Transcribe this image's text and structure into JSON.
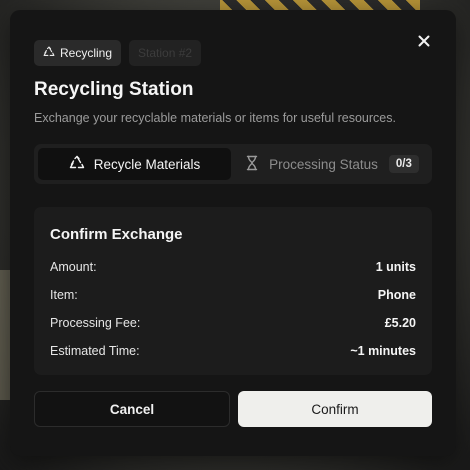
{
  "badges": {
    "primary": {
      "icon": "recycle-icon",
      "label": "Recycling"
    },
    "secondary": {
      "label": "Station #2"
    }
  },
  "close": {
    "icon": "close-icon"
  },
  "header": {
    "title": "Recycling Station",
    "subtitle": "Exchange your recyclable materials or items for useful resources."
  },
  "tabs": [
    {
      "icon": "recycle-icon",
      "label": "Recycle Materials",
      "active": true
    },
    {
      "icon": "hourglass-icon",
      "label": "Processing Status",
      "count": "0/3",
      "active": false
    }
  ],
  "confirm_card": {
    "title": "Confirm Exchange",
    "rows": [
      {
        "label": "Amount:",
        "value": "1 units"
      },
      {
        "label": "Item:",
        "value": "Phone"
      },
      {
        "label": "Processing Fee:",
        "value": "£5.20"
      },
      {
        "label": "Estimated Time:",
        "value": "~1 minutes"
      }
    ]
  },
  "actions": {
    "cancel_label": "Cancel",
    "confirm_label": "Confirm"
  },
  "colors": {
    "modal_bg": "#151515",
    "card_bg": "#1c1c1c",
    "confirm_bg": "#efefec",
    "muted_text": "#9b9b9b"
  }
}
